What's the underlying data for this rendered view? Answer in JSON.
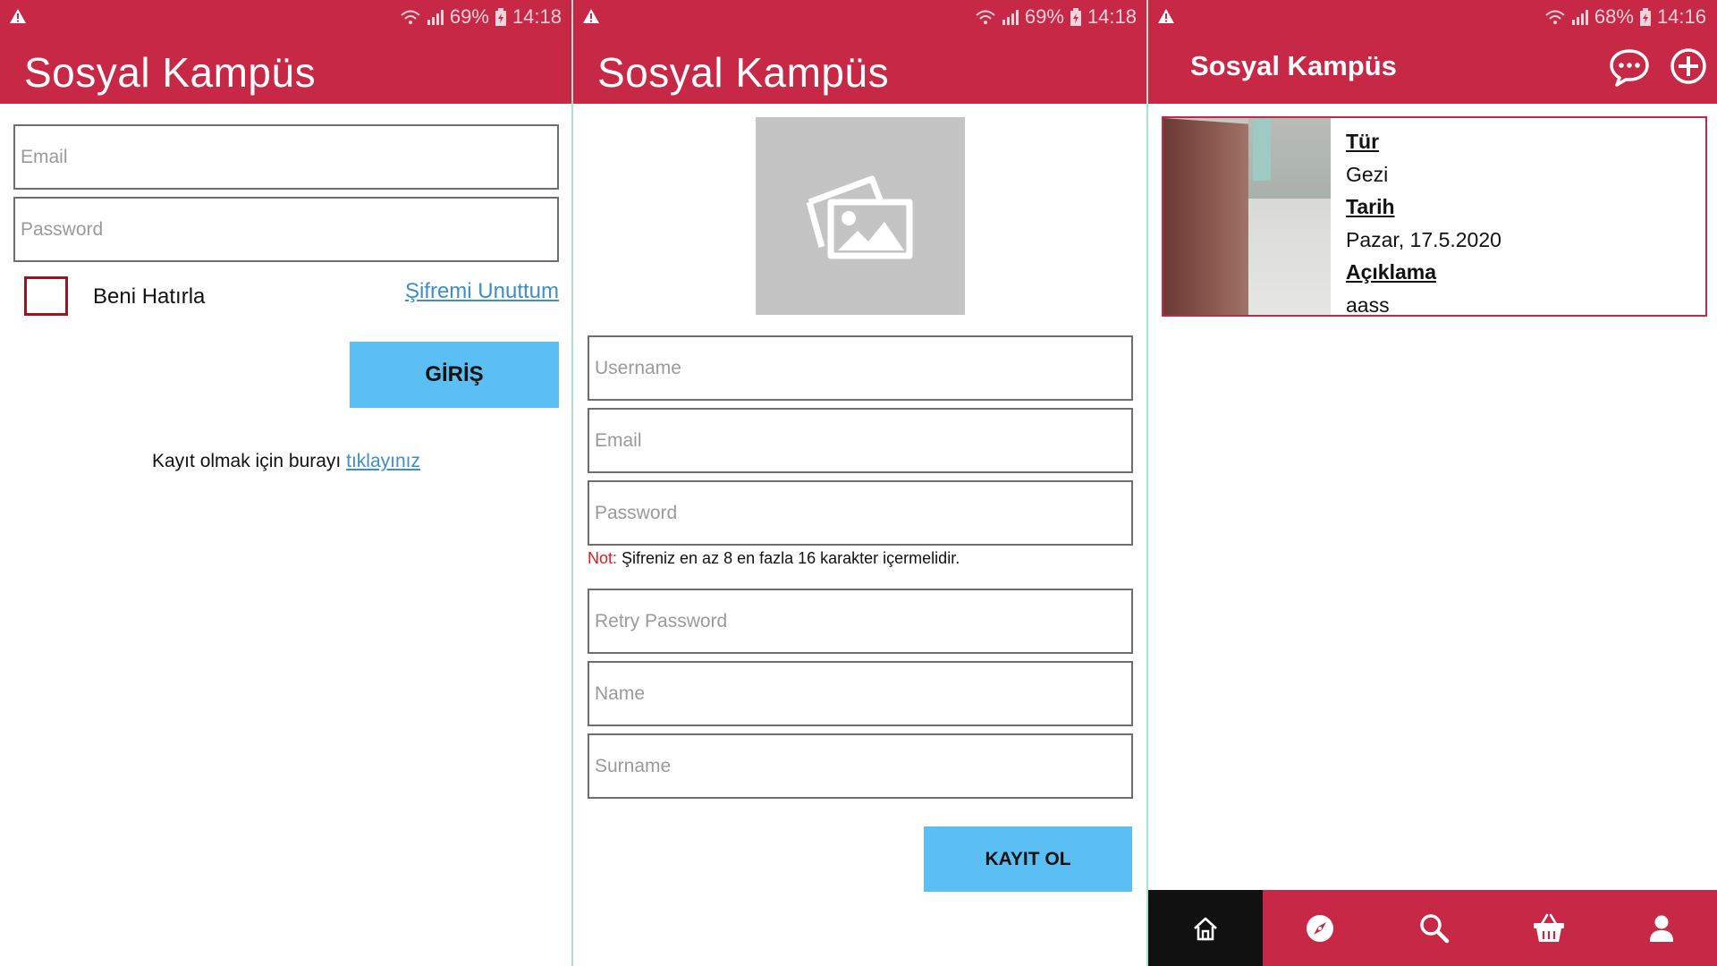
{
  "colors": {
    "brand": "#c62845",
    "button": "#5bbff3",
    "link": "#3b8fc4",
    "note_red": "#e11b1b",
    "nav_active": "#111111"
  },
  "login_screen": {
    "status": {
      "battery": "69%",
      "time": "14:18"
    },
    "app_title": "Sosyal Kampüs",
    "email_placeholder": "Email",
    "password_placeholder": "Password",
    "remember_label": "Beni Hatırla",
    "forgot_link": "Şifremi Unuttum",
    "login_button": "GİRİŞ",
    "register_prompt": "Kayıt olmak için burayı",
    "register_link": "tıklayınız"
  },
  "register_screen": {
    "status": {
      "battery": "69%",
      "time": "14:18"
    },
    "app_title": "Sosyal Kampüs",
    "photo_icon": "image-placeholder-icon",
    "username_placeholder": "Username",
    "email_placeholder": "Email",
    "password_placeholder": "Password",
    "note_label": "Not:",
    "note_text": " Şifreniz en az 8 en fazla 16 karakter içermelidir.",
    "retry_password_placeholder": "Retry Password",
    "name_placeholder": "Name",
    "surname_placeholder": "Surname",
    "register_button": "KAYIT OL"
  },
  "feed_screen": {
    "status": {
      "battery": "68%",
      "time": "14:16"
    },
    "app_title": "Sosyal Kampüs",
    "header_icons": [
      "chat-bubble-icon",
      "add-circle-icon"
    ],
    "post": {
      "type_label": "Tür",
      "type_value": "Gezi",
      "date_label": "Tarih",
      "date_value": "Pazar, 17.5.2020",
      "description_label": "Açıklama",
      "description_value": "aass"
    },
    "bottom_nav": [
      {
        "icon": "home-icon",
        "active": true
      },
      {
        "icon": "compass-icon",
        "active": false
      },
      {
        "icon": "search-icon",
        "active": false
      },
      {
        "icon": "basket-icon",
        "active": false
      },
      {
        "icon": "profile-icon",
        "active": false
      }
    ]
  }
}
